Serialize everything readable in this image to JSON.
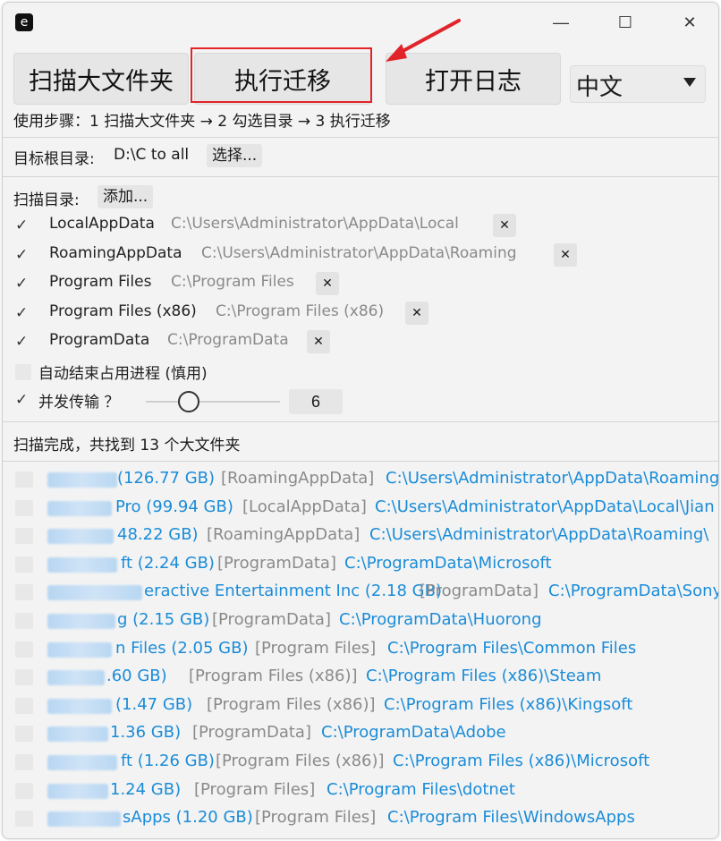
{
  "window": {
    "app_icon": "e",
    "min_icon": "—",
    "max_icon": "☐",
    "close_icon": "✕"
  },
  "toolbar": {
    "scan_label": "扫描大文件夹",
    "exec_label": "执行迁移",
    "log_label": "打开日志",
    "lang_value": "中文"
  },
  "steps_text": "使用步骤：1 扫描大文件夹 → 2 勾选目录 → 3 执行迁移",
  "target": {
    "label": "目标根目录:",
    "value": "D:\\C to all",
    "choose_label": "选择..."
  },
  "scan_dirs": {
    "label": "扫描目录:",
    "add_label": "添加...",
    "items": [
      {
        "check": "✓",
        "name": "LocalAppData",
        "path": "C:\\Users\\Administrator\\AppData\\Local",
        "remove": "✕"
      },
      {
        "check": "✓",
        "name": "RoamingAppData",
        "path": "C:\\Users\\Administrator\\AppData\\Roaming",
        "remove": "✕"
      },
      {
        "check": "✓",
        "name": "Program Files",
        "path": "C:\\Program Files",
        "remove": "✕"
      },
      {
        "check": "✓",
        "name": "Program Files (x86)",
        "path": "C:\\Program Files (x86)",
        "remove": "✕"
      },
      {
        "check": "✓",
        "name": "ProgramData",
        "path": "C:\\ProgramData",
        "remove": "✕"
      }
    ]
  },
  "options": {
    "auto_kill": "自动结束占用进程 (慎用)",
    "concurrency_check": "✓",
    "concurrency_label": "并发传输 ？",
    "concurrency_value": "6",
    "concurrency_fraction": 0.25
  },
  "status_text": "扫描完成，共找到 13 个大文件夹",
  "results": [
    {
      "name": "(126.77 GB)",
      "cat": "[RoamingAppData]",
      "path": "C:\\Users\\Administrator\\AppData\\Roaming"
    },
    {
      "name": "Pro (99.94 GB)",
      "cat": "[LocalAppData]",
      "path": "C:\\Users\\Administrator\\AppData\\Local\\Jian"
    },
    {
      "name": "48.22 GB)",
      "cat": "[RoamingAppData]",
      "path": "C:\\Users\\Administrator\\AppData\\Roaming\\"
    },
    {
      "name": "ft (2.24 GB)",
      "cat": "[ProgramData]",
      "path": "C:\\ProgramData\\Microsoft"
    },
    {
      "name": "eractive Entertainment Inc (2.18 GB)",
      "cat": "[ProgramData]",
      "path": "C:\\ProgramData\\Sony"
    },
    {
      "name": "g (2.15 GB)",
      "cat": "[ProgramData]",
      "path": "C:\\ProgramData\\Huorong"
    },
    {
      "name": "n Files (2.05 GB)",
      "cat": "[Program Files]",
      "path": "C:\\Program Files\\Common Files"
    },
    {
      "name": ".60 GB)",
      "cat": "[Program Files (x86)]",
      "path": "C:\\Program Files (x86)\\Steam"
    },
    {
      "name": "(1.47 GB)",
      "cat": "[Program Files (x86)]",
      "path": "C:\\Program Files (x86)\\Kingsoft"
    },
    {
      "name": "1.36 GB)",
      "cat": "[ProgramData]",
      "path": "C:\\ProgramData\\Adobe"
    },
    {
      "name": "ft (1.26 GB)",
      "cat": "[Program Files (x86)]",
      "path": "C:\\Program Files (x86)\\Microsoft"
    },
    {
      "name": "1.24 GB)",
      "cat": "[Program Files]",
      "path": "C:\\Program Files\\dotnet"
    },
    {
      "name": "sApps (1.20 GB)",
      "cat": "[Program Files]",
      "path": "C:\\Program Files\\WindowsApps"
    }
  ]
}
